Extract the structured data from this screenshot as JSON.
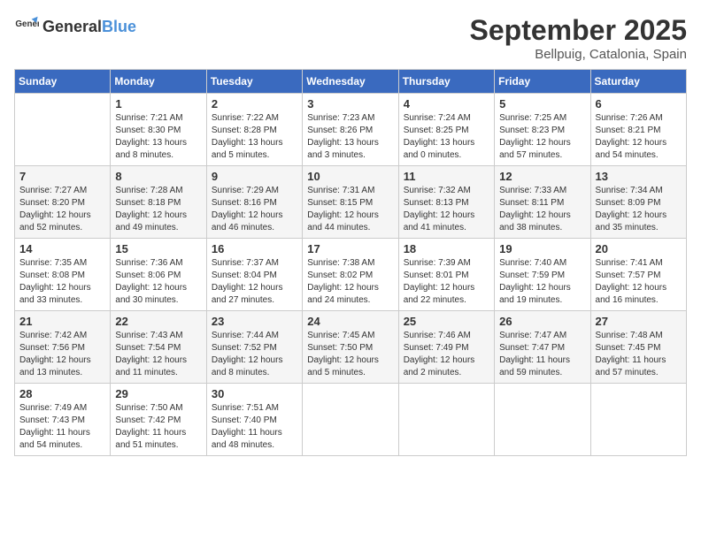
{
  "header": {
    "logo_general": "General",
    "logo_blue": "Blue",
    "month_title": "September 2025",
    "location": "Bellpuig, Catalonia, Spain"
  },
  "days_of_week": [
    "Sunday",
    "Monday",
    "Tuesday",
    "Wednesday",
    "Thursday",
    "Friday",
    "Saturday"
  ],
  "weeks": [
    [
      {
        "day": "",
        "info": ""
      },
      {
        "day": "1",
        "info": "Sunrise: 7:21 AM\nSunset: 8:30 PM\nDaylight: 13 hours\nand 8 minutes."
      },
      {
        "day": "2",
        "info": "Sunrise: 7:22 AM\nSunset: 8:28 PM\nDaylight: 13 hours\nand 5 minutes."
      },
      {
        "day": "3",
        "info": "Sunrise: 7:23 AM\nSunset: 8:26 PM\nDaylight: 13 hours\nand 3 minutes."
      },
      {
        "day": "4",
        "info": "Sunrise: 7:24 AM\nSunset: 8:25 PM\nDaylight: 13 hours\nand 0 minutes."
      },
      {
        "day": "5",
        "info": "Sunrise: 7:25 AM\nSunset: 8:23 PM\nDaylight: 12 hours\nand 57 minutes."
      },
      {
        "day": "6",
        "info": "Sunrise: 7:26 AM\nSunset: 8:21 PM\nDaylight: 12 hours\nand 54 minutes."
      }
    ],
    [
      {
        "day": "7",
        "info": "Sunrise: 7:27 AM\nSunset: 8:20 PM\nDaylight: 12 hours\nand 52 minutes."
      },
      {
        "day": "8",
        "info": "Sunrise: 7:28 AM\nSunset: 8:18 PM\nDaylight: 12 hours\nand 49 minutes."
      },
      {
        "day": "9",
        "info": "Sunrise: 7:29 AM\nSunset: 8:16 PM\nDaylight: 12 hours\nand 46 minutes."
      },
      {
        "day": "10",
        "info": "Sunrise: 7:31 AM\nSunset: 8:15 PM\nDaylight: 12 hours\nand 44 minutes."
      },
      {
        "day": "11",
        "info": "Sunrise: 7:32 AM\nSunset: 8:13 PM\nDaylight: 12 hours\nand 41 minutes."
      },
      {
        "day": "12",
        "info": "Sunrise: 7:33 AM\nSunset: 8:11 PM\nDaylight: 12 hours\nand 38 minutes."
      },
      {
        "day": "13",
        "info": "Sunrise: 7:34 AM\nSunset: 8:09 PM\nDaylight: 12 hours\nand 35 minutes."
      }
    ],
    [
      {
        "day": "14",
        "info": "Sunrise: 7:35 AM\nSunset: 8:08 PM\nDaylight: 12 hours\nand 33 minutes."
      },
      {
        "day": "15",
        "info": "Sunrise: 7:36 AM\nSunset: 8:06 PM\nDaylight: 12 hours\nand 30 minutes."
      },
      {
        "day": "16",
        "info": "Sunrise: 7:37 AM\nSunset: 8:04 PM\nDaylight: 12 hours\nand 27 minutes."
      },
      {
        "day": "17",
        "info": "Sunrise: 7:38 AM\nSunset: 8:02 PM\nDaylight: 12 hours\nand 24 minutes."
      },
      {
        "day": "18",
        "info": "Sunrise: 7:39 AM\nSunset: 8:01 PM\nDaylight: 12 hours\nand 22 minutes."
      },
      {
        "day": "19",
        "info": "Sunrise: 7:40 AM\nSunset: 7:59 PM\nDaylight: 12 hours\nand 19 minutes."
      },
      {
        "day": "20",
        "info": "Sunrise: 7:41 AM\nSunset: 7:57 PM\nDaylight: 12 hours\nand 16 minutes."
      }
    ],
    [
      {
        "day": "21",
        "info": "Sunrise: 7:42 AM\nSunset: 7:56 PM\nDaylight: 12 hours\nand 13 minutes."
      },
      {
        "day": "22",
        "info": "Sunrise: 7:43 AM\nSunset: 7:54 PM\nDaylight: 12 hours\nand 11 minutes."
      },
      {
        "day": "23",
        "info": "Sunrise: 7:44 AM\nSunset: 7:52 PM\nDaylight: 12 hours\nand 8 minutes."
      },
      {
        "day": "24",
        "info": "Sunrise: 7:45 AM\nSunset: 7:50 PM\nDaylight: 12 hours\nand 5 minutes."
      },
      {
        "day": "25",
        "info": "Sunrise: 7:46 AM\nSunset: 7:49 PM\nDaylight: 12 hours\nand 2 minutes."
      },
      {
        "day": "26",
        "info": "Sunrise: 7:47 AM\nSunset: 7:47 PM\nDaylight: 11 hours\nand 59 minutes."
      },
      {
        "day": "27",
        "info": "Sunrise: 7:48 AM\nSunset: 7:45 PM\nDaylight: 11 hours\nand 57 minutes."
      }
    ],
    [
      {
        "day": "28",
        "info": "Sunrise: 7:49 AM\nSunset: 7:43 PM\nDaylight: 11 hours\nand 54 minutes."
      },
      {
        "day": "29",
        "info": "Sunrise: 7:50 AM\nSunset: 7:42 PM\nDaylight: 11 hours\nand 51 minutes."
      },
      {
        "day": "30",
        "info": "Sunrise: 7:51 AM\nSunset: 7:40 PM\nDaylight: 11 hours\nand 48 minutes."
      },
      {
        "day": "",
        "info": ""
      },
      {
        "day": "",
        "info": ""
      },
      {
        "day": "",
        "info": ""
      },
      {
        "day": "",
        "info": ""
      }
    ]
  ]
}
